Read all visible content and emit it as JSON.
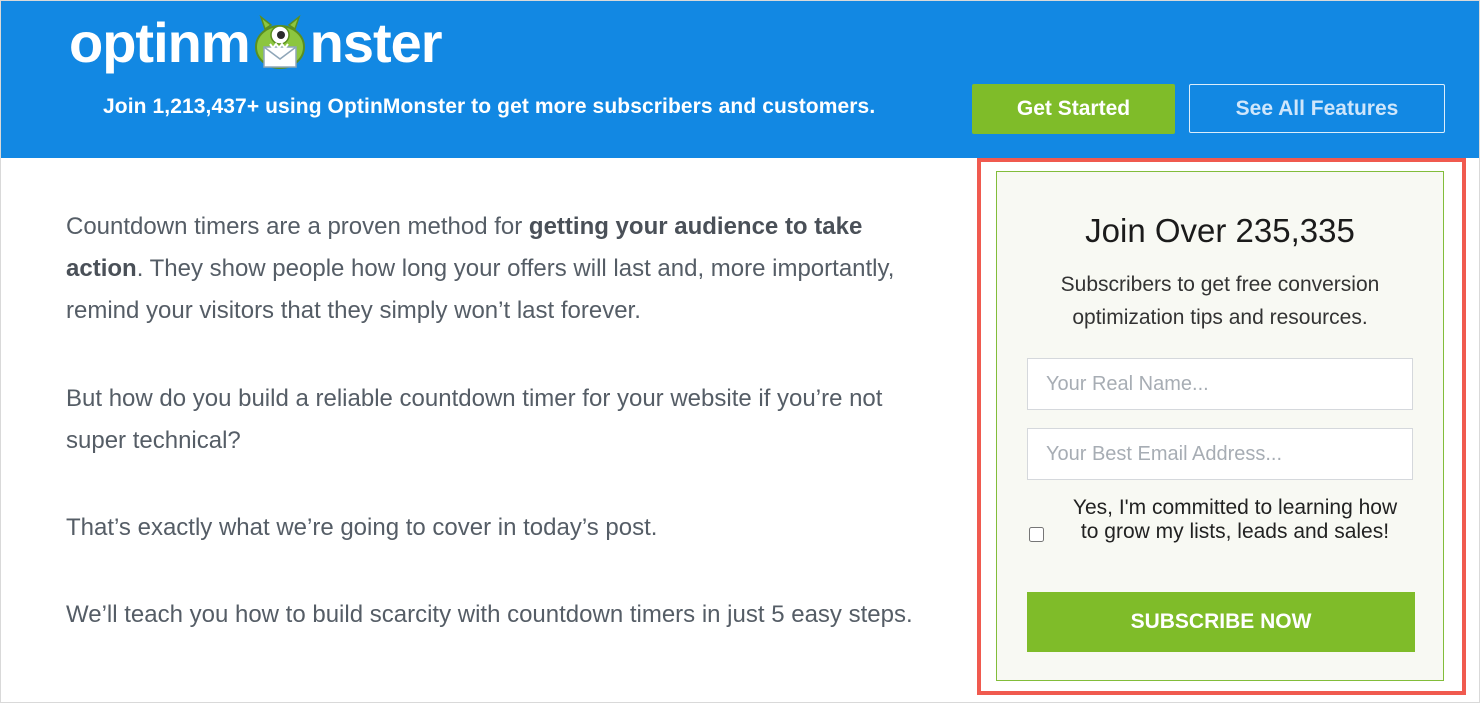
{
  "header": {
    "logo": {
      "prefix": "optinm",
      "suffix": "nster",
      "icon": "monster-mascot-icon"
    },
    "tagline": "Join 1,213,437+ using OptinMonster to get more subscribers and customers.",
    "get_started_label": "Get Started",
    "see_features_label": "See All Features"
  },
  "article": {
    "p1_pre": "Countdown timers are a proven method for ",
    "p1_bold": "getting your audience to take action",
    "p1_post": ". They show people how long your offers will last and, more importantly, remind your visitors that they simply won’t last forever.",
    "p2": "But how do you build a reliable countdown timer for your website if you’re not super technical?",
    "p3": "That’s exactly what we’re going to cover in today’s post.",
    "p4": "We’ll teach you how to build scarcity with countdown timers in just 5 easy steps."
  },
  "optin": {
    "title": "Join Over 235,335",
    "subtitle": "Subscribers to get free conversion optimization tips and resources.",
    "name_placeholder": "Your Real Name...",
    "email_placeholder": "Your Best Email Address...",
    "checkbox_label": "Yes, I'm committed to learning how to grow my lists, leads and sales!",
    "checkbox_checked": false,
    "subscribe_label": "SUBSCRIBE NOW"
  },
  "colors": {
    "header_bg": "#1288e3",
    "accent_green": "#7fbc29",
    "highlight_red": "#f05a4f",
    "optin_border": "#82bd3a"
  }
}
